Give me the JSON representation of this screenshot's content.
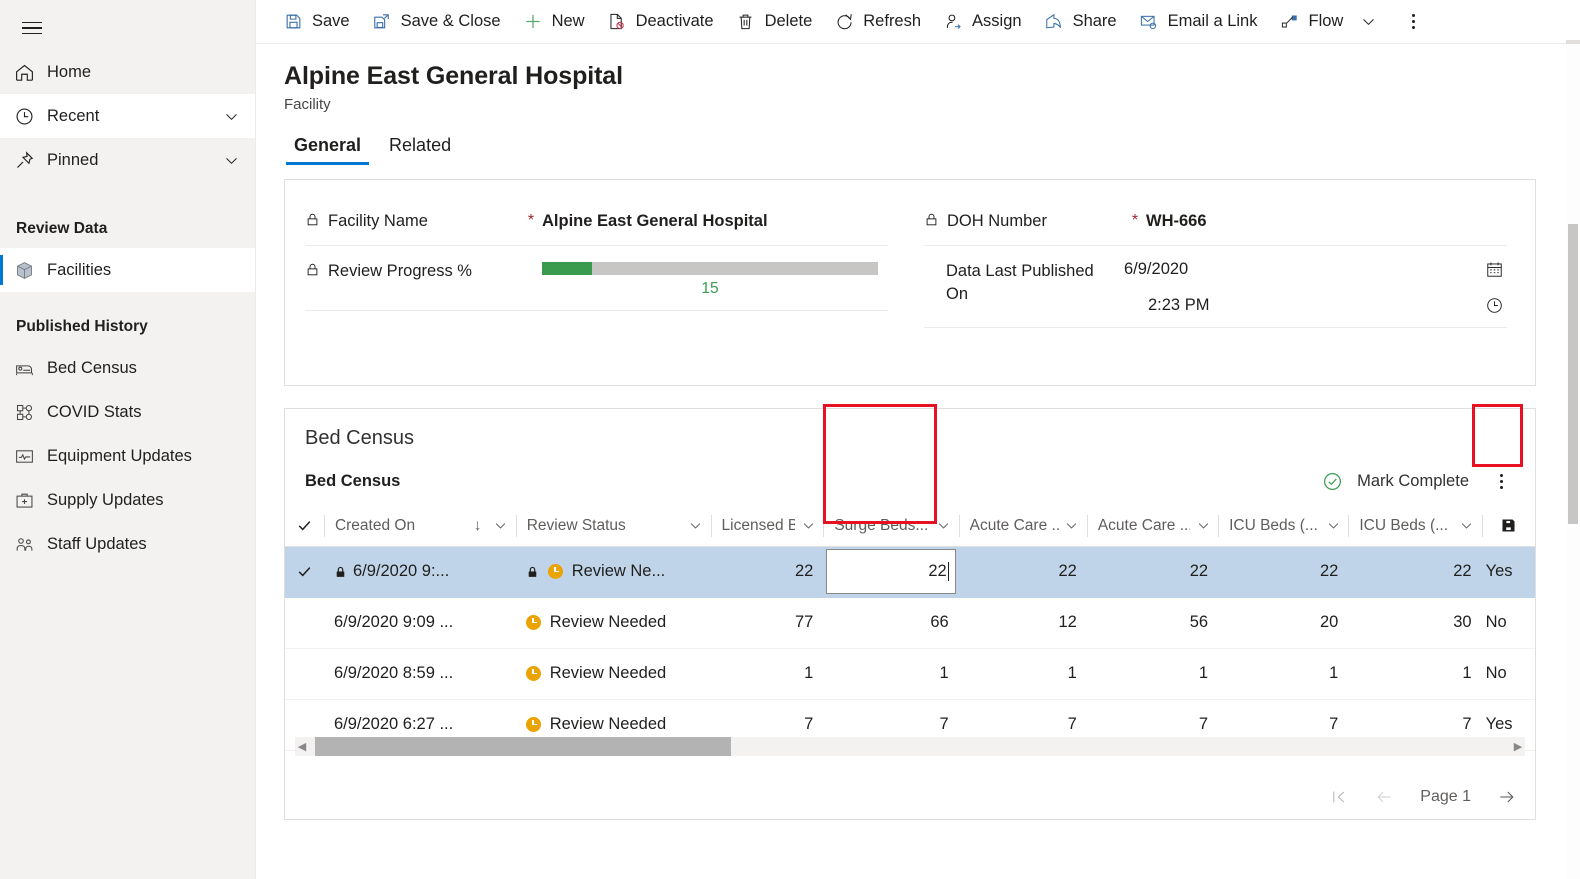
{
  "sidebar": {
    "menu_icon": "hamburger-icon",
    "items": [
      {
        "label": "Home",
        "icon": "home-icon",
        "chevron": false,
        "state": "plain"
      },
      {
        "label": "Recent",
        "icon": "clock-icon",
        "chevron": true,
        "state": "white"
      },
      {
        "label": "Pinned",
        "icon": "pin-icon",
        "chevron": true,
        "state": "plain"
      }
    ],
    "groups": [
      {
        "title": "Review Data",
        "items": [
          {
            "label": "Facilities",
            "icon": "cube-icon",
            "selected": true
          }
        ]
      },
      {
        "title": "Published History",
        "items": [
          {
            "label": "Bed Census",
            "icon": "bed-icon",
            "selected": false
          },
          {
            "label": "COVID Stats",
            "icon": "covid-stats-icon",
            "selected": false
          },
          {
            "label": "Equipment Updates",
            "icon": "equipment-icon",
            "selected": false
          },
          {
            "label": "Supply Updates",
            "icon": "medical-kit-icon",
            "selected": false
          },
          {
            "label": "Staff Updates",
            "icon": "staff-icon",
            "selected": false
          }
        ]
      }
    ]
  },
  "toolbar": {
    "save": "Save",
    "save_close": "Save & Close",
    "new": "New",
    "deactivate": "Deactivate",
    "delete": "Delete",
    "refresh": "Refresh",
    "assign": "Assign",
    "share": "Share",
    "email_link": "Email a Link",
    "flow": "Flow",
    "overflow_icon": "more-vertical-icon"
  },
  "record": {
    "title": "Alpine East General Hospital",
    "subtitle": "Facility",
    "tabs": [
      {
        "label": "General",
        "active": true
      },
      {
        "label": "Related",
        "active": false
      }
    ]
  },
  "form": {
    "left": {
      "facility_name_label": "Facility Name",
      "facility_name_required": "*",
      "facility_name_value": "Alpine East General Hospital",
      "review_progress_label": "Review Progress %",
      "review_progress_value": "15",
      "review_progress_percent": 15,
      "progress_color": "#3a9b4e"
    },
    "right": {
      "doh_label": "DOH Number",
      "doh_required": "*",
      "doh_value": "WH-666",
      "published_label": "Data Last Published On",
      "published_label_line1": "Data Last Published",
      "published_label_line2": "On",
      "published_date": "6/9/2020",
      "published_time": "2:23 PM",
      "date_icon": "calendar-icon",
      "time_icon": "clock-icon"
    }
  },
  "grid_section": {
    "section_title": "Bed Census",
    "sub_title": "Bed Census",
    "mark_complete": "Mark Complete",
    "mark_complete_icon": "check-circle-icon",
    "mark_complete_color": "#3a9b4e",
    "more_icon": "more-vertical-icon",
    "save_cell_icon": "save-floppy-icon"
  },
  "table": {
    "columns": [
      {
        "label": "",
        "key": "check",
        "sortable": false
      },
      {
        "label": "Created On",
        "key": "created_on",
        "sort": "↓",
        "chevron": true
      },
      {
        "label": "Review Status",
        "key": "review_status",
        "chevron": true
      },
      {
        "label": "Licensed B...",
        "key": "licensed_beds",
        "chevron": true
      },
      {
        "label": "Surge Beds...",
        "key": "surge_beds",
        "chevron": true,
        "highlighted": true
      },
      {
        "label": "Acute Care ...",
        "key": "acute_care_1",
        "chevron": true
      },
      {
        "label": "Acute Care ...",
        "key": "acute_care_2",
        "chevron": true
      },
      {
        "label": "ICU Beds (...",
        "key": "icu_beds_1",
        "chevron": true
      },
      {
        "label": "ICU Beds (...",
        "key": "icu_beds_2",
        "chevron": true
      },
      {
        "label": "",
        "key": "save",
        "chevron": false
      }
    ],
    "rows": [
      {
        "selected": true,
        "checked": true,
        "locked": true,
        "created_on": "6/9/2020 9:...",
        "status_locked": true,
        "review_status": "Review Ne...",
        "licensed_beds": "22",
        "surge_beds": "22",
        "surge_beds_editing": true,
        "acute_care_1": "22",
        "acute_care_2": "22",
        "icu_beds_1": "22",
        "icu_beds_2": "22",
        "last": "Yes"
      },
      {
        "selected": false,
        "checked": false,
        "locked": false,
        "created_on": "6/9/2020 9:09 ...",
        "review_status": "Review Needed",
        "licensed_beds": "77",
        "surge_beds": "66",
        "acute_care_1": "12",
        "acute_care_2": "56",
        "icu_beds_1": "20",
        "icu_beds_2": "30",
        "last": "No"
      },
      {
        "selected": false,
        "checked": false,
        "locked": false,
        "created_on": "6/9/2020 8:59 ...",
        "review_status": "Review Needed",
        "licensed_beds": "1",
        "surge_beds": "1",
        "acute_care_1": "1",
        "acute_care_2": "1",
        "icu_beds_1": "1",
        "icu_beds_2": "1",
        "last": "No"
      },
      {
        "selected": false,
        "checked": false,
        "locked": false,
        "created_on": "6/9/2020 6:27 ...",
        "review_status": "Review Needed",
        "licensed_beds": "7",
        "surge_beds": "7",
        "acute_care_1": "7",
        "acute_care_2": "7",
        "icu_beds_1": "7",
        "icu_beds_2": "7",
        "last": "Yes"
      }
    ]
  },
  "pager": {
    "first_icon": "page-first-icon",
    "prev_icon": "page-prev-icon",
    "label": "Page 1",
    "next_icon": "page-next-icon"
  },
  "colors": {
    "accent": "#0078d4",
    "required": "#a4262c",
    "progress_green": "#3a9b4e",
    "status_amber": "#eaa300",
    "row_selected": "#bfd4e9",
    "annotation_red": "#e81123"
  }
}
